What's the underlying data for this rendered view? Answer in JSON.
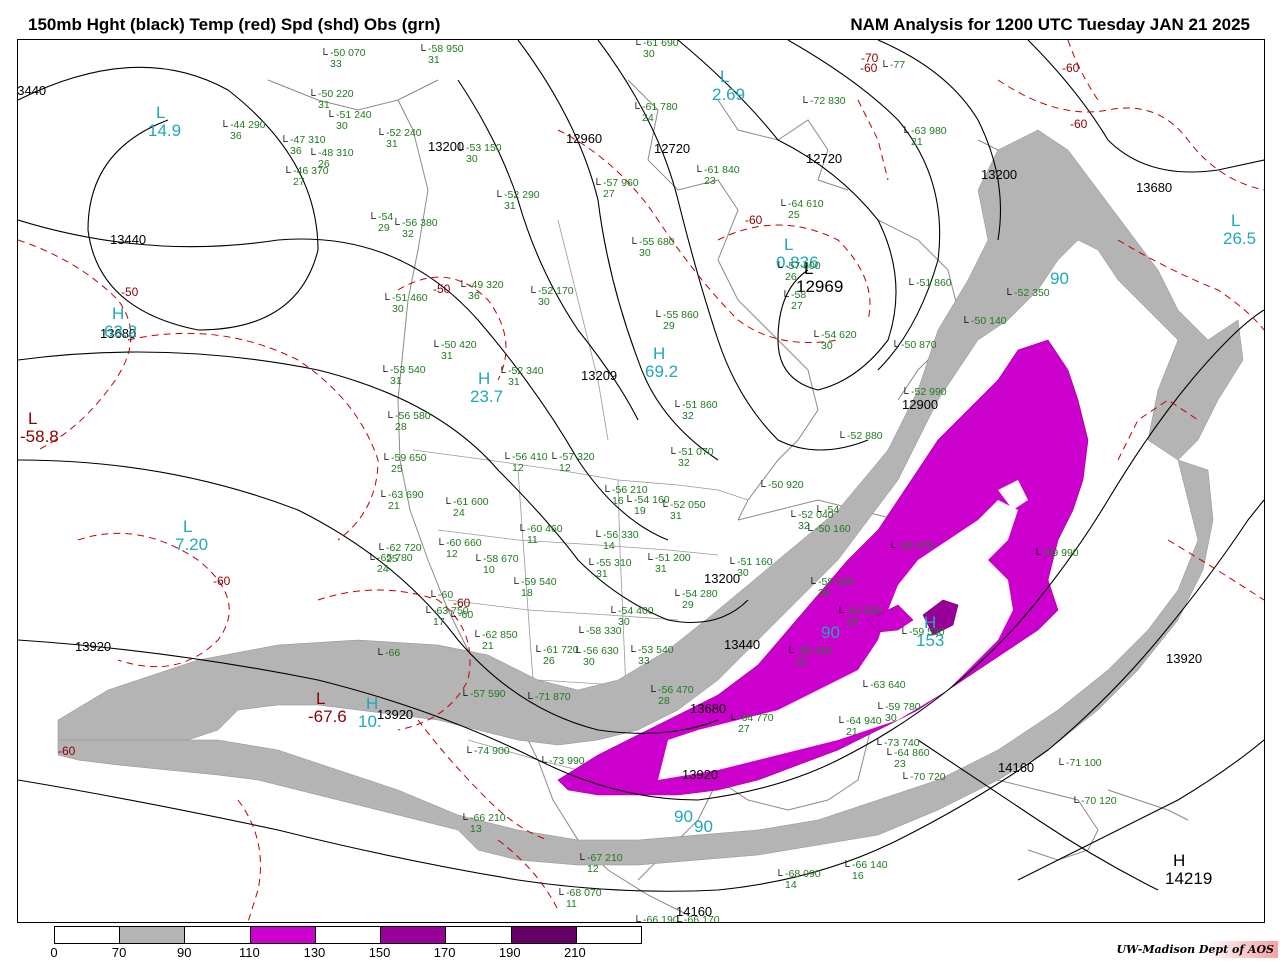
{
  "header": {
    "left_title": "150mb Hght (black) Temp (red) Spd (shd) Obs (grn)",
    "right_title": "NAM Analysis for 1200 UTC Tuesday  JAN 21 2025"
  },
  "colors": {
    "height_contour": "#000000",
    "temperature_contour": "#c00000",
    "speed_label": "#1fa9b7",
    "observation": "#1f7a1f",
    "speed_70_90": "#b4b4b4",
    "speed_110_130": "#cc00cc",
    "speed_150_170": "#990099",
    "speed_190_210": "#660066"
  },
  "legend": {
    "ticks": [
      "0",
      "70",
      "90",
      "110",
      "130",
      "150",
      "170",
      "190",
      "210"
    ],
    "fills": [
      "#ffffff",
      "#b4b4b4",
      "#ffffff",
      "#cc00cc",
      "#ffffff",
      "#990099",
      "#ffffff",
      "#660066",
      "#ffffff"
    ]
  },
  "credit": "UW-Madison  Dept of AOS",
  "height_labels": [
    "13440",
    "13440",
    "13200",
    "12960",
    "12720",
    "12720",
    "13200",
    "13680",
    "13680",
    "13209",
    "12900",
    "13200",
    "13440",
    "13680",
    "13920",
    "13920",
    "13920",
    "14160",
    "14160",
    "13920"
  ],
  "temp_labels": [
    "-50",
    "-60",
    "-60",
    "-60",
    "-70",
    "-60",
    "-60",
    "-50",
    "-60",
    "-60"
  ],
  "speed_labels": [
    "90",
    "90",
    "90",
    "90"
  ],
  "centers": [
    {
      "letter": "L",
      "value": "14.9",
      "kind": "spd"
    },
    {
      "letter": "L",
      "value": "2.69",
      "kind": "spd"
    },
    {
      "letter": "L",
      "value": "0.836",
      "kind": "spd"
    },
    {
      "letter": "L",
      "value": "12969",
      "kind": "hgt"
    },
    {
      "letter": "L",
      "value": "26.5",
      "kind": "spd"
    },
    {
      "letter": "H",
      "value": "69.2",
      "kind": "spd"
    },
    {
      "letter": "H",
      "value": "63.2",
      "kind": "spd"
    },
    {
      "letter": "L",
      "value": "7.20",
      "kind": "spd"
    },
    {
      "letter": "L",
      "value": "-58.8",
      "kind": "tmp"
    },
    {
      "letter": "L",
      "value": "-67.6",
      "kind": "tmp"
    },
    {
      "letter": "H",
      "value": "10.",
      "kind": "spd"
    },
    {
      "letter": "H",
      "value": "23.7",
      "kind": "spd"
    },
    {
      "letter": "H",
      "value": "153",
      "kind": "spd"
    },
    {
      "letter": "H",
      "value": "14219",
      "kind": "hgt"
    }
  ],
  "observations": [
    {
      "t": "-50",
      "h": "070",
      "d": "33"
    },
    {
      "t": "-58",
      "h": "950",
      "d": "31"
    },
    {
      "t": "-61",
      "h": "690",
      "d": "30"
    },
    {
      "t": "-61",
      "h": "780",
      "d": "24"
    },
    {
      "t": "-72",
      "h": "830",
      "d": ""
    },
    {
      "t": "-77",
      "h": "",
      "d": ""
    },
    {
      "t": "-63",
      "h": "980",
      "d": "21"
    },
    {
      "t": "-61",
      "h": "840",
      "d": "23"
    },
    {
      "t": "-50",
      "h": "220",
      "d": "31"
    },
    {
      "t": "-44",
      "h": "290",
      "d": "36"
    },
    {
      "t": "-51",
      "h": "240",
      "d": "30"
    },
    {
      "t": "-52",
      "h": "240",
      "d": "31"
    },
    {
      "t": "-47",
      "h": "310",
      "d": "36"
    },
    {
      "t": "-48",
      "h": "310",
      "d": "26"
    },
    {
      "t": "-46",
      "h": "370",
      "d": "27"
    },
    {
      "t": "-53",
      "h": "150",
      "d": "30"
    },
    {
      "t": "-57",
      "h": "960",
      "d": "27"
    },
    {
      "t": "-64",
      "h": "610",
      "d": "25"
    },
    {
      "t": "-57",
      "h": "600",
      "d": "26"
    },
    {
      "t": "-58",
      "h": "",
      "d": "27"
    },
    {
      "t": "-52",
      "h": "290",
      "d": "31"
    },
    {
      "t": "-54",
      "h": "",
      "d": "29"
    },
    {
      "t": "-56",
      "h": "380",
      "d": "32"
    },
    {
      "t": "-55",
      "h": "680",
      "d": "30"
    },
    {
      "t": "-51",
      "h": "860",
      "d": ""
    },
    {
      "t": "-52",
      "h": "350",
      "d": ""
    },
    {
      "t": "-49",
      "h": "320",
      "d": "36"
    },
    {
      "t": "-52",
      "h": "170",
      "d": "30"
    },
    {
      "t": "-54",
      "h": "620",
      "d": "30"
    },
    {
      "t": "-50",
      "h": "140",
      "d": ""
    },
    {
      "t": "-51",
      "h": "460",
      "d": "30"
    },
    {
      "t": "-55",
      "h": "860",
      "d": "29"
    },
    {
      "t": "-50",
      "h": "420",
      "d": "31"
    },
    {
      "t": "-52",
      "h": "340",
      "d": "31"
    },
    {
      "t": "-50",
      "h": "870",
      "d": ""
    },
    {
      "t": "-53",
      "h": "540",
      "d": "31"
    },
    {
      "t": "-56",
      "h": "580",
      "d": "28"
    },
    {
      "t": "-52",
      "h": "990",
      "d": ""
    },
    {
      "t": "-51",
      "h": "860",
      "d": "32"
    },
    {
      "t": "-52",
      "h": "880",
      "d": ""
    },
    {
      "t": "-59",
      "h": "650",
      "d": "25"
    },
    {
      "t": "-56",
      "h": "410",
      "d": "12"
    },
    {
      "t": "-57",
      "h": "320",
      "d": "12"
    },
    {
      "t": "-51",
      "h": "070",
      "d": "32"
    },
    {
      "t": "-50",
      "h": "920",
      "d": ""
    },
    {
      "t": "-63",
      "h": "690",
      "d": "21"
    },
    {
      "t": "-61",
      "h": "600",
      "d": "24"
    },
    {
      "t": "-56",
      "h": "210",
      "d": "16"
    },
    {
      "t": "-54",
      "h": "160",
      "d": "19"
    },
    {
      "t": "-52",
      "h": "050",
      "d": "31"
    },
    {
      "t": "-52",
      "h": "040",
      "d": "32"
    },
    {
      "t": "-54",
      "h": "",
      "d": ""
    },
    {
      "t": "-62",
      "h": "720",
      "d": "25"
    },
    {
      "t": "-60",
      "h": "660",
      "d": "12"
    },
    {
      "t": "-60",
      "h": "460",
      "d": "11"
    },
    {
      "t": "-56",
      "h": "330",
      "d": "14"
    },
    {
      "t": "-58",
      "h": "670",
      "d": "10"
    },
    {
      "t": "-60",
      "h": "",
      "d": ""
    },
    {
      "t": "-51",
      "h": "200",
      "d": "31"
    },
    {
      "t": "-51",
      "h": "160",
      "d": "30"
    },
    {
      "t": "-50",
      "h": "160",
      "d": ""
    },
    {
      "t": "-53",
      "h": "470",
      "d": ""
    },
    {
      "t": "-69",
      "h": "990",
      "d": ""
    },
    {
      "t": "-65",
      "h": "780",
      "d": "24"
    },
    {
      "t": "-59",
      "h": "540",
      "d": "18"
    },
    {
      "t": "-55",
      "h": "310",
      "d": "31"
    },
    {
      "t": "-54",
      "h": "280",
      "d": "29"
    },
    {
      "t": "-58",
      "h": "450",
      "d": "29"
    },
    {
      "t": "-61",
      "h": "530",
      "d": "23"
    },
    {
      "t": "-63",
      "h": "750",
      "d": "17"
    },
    {
      "t": "-60",
      "h": "",
      "d": ""
    },
    {
      "t": "-54",
      "h": "400",
      "d": "30"
    },
    {
      "t": "-58",
      "h": "330",
      "d": ""
    },
    {
      "t": "-59",
      "h": "530",
      "d": ""
    },
    {
      "t": "-66",
      "h": "",
      "d": ""
    },
    {
      "t": "-62",
      "h": "850",
      "d": "21"
    },
    {
      "t": "-61",
      "h": "720",
      "d": "26"
    },
    {
      "t": "-56",
      "h": "630",
      "d": "30"
    },
    {
      "t": "-53",
      "h": "540",
      "d": "33"
    },
    {
      "t": "-56",
      "h": "410",
      "d": "31"
    },
    {
      "t": "-56",
      "h": "470",
      "d": "28"
    },
    {
      "t": "-63",
      "h": "640",
      "d": ""
    },
    {
      "t": "-57",
      "h": "590",
      "d": ""
    },
    {
      "t": "-71",
      "h": "870",
      "d": ""
    },
    {
      "t": "-64",
      "h": "770",
      "d": "27"
    },
    {
      "t": "-59",
      "h": "780",
      "d": "30"
    },
    {
      "t": "-73",
      "h": "740",
      "d": ""
    },
    {
      "t": "-74",
      "h": "900",
      "d": ""
    },
    {
      "t": "-73",
      "h": "990",
      "d": ""
    },
    {
      "t": "-64",
      "h": "940",
      "d": "21"
    },
    {
      "t": "-64",
      "h": "860",
      "d": "23"
    },
    {
      "t": "-70",
      "h": "720",
      "d": ""
    },
    {
      "t": "-71",
      "h": "100",
      "d": ""
    },
    {
      "t": "-70",
      "h": "120",
      "d": ""
    },
    {
      "t": "-66",
      "h": "210",
      "d": "13"
    },
    {
      "t": "-67",
      "h": "210",
      "d": "12"
    },
    {
      "t": "-68",
      "h": "070",
      "d": "11"
    },
    {
      "t": "-68",
      "h": "090",
      "d": "14"
    },
    {
      "t": "-66",
      "h": "140",
      "d": "16"
    },
    {
      "t": "-66",
      "h": "190",
      "d": "14"
    },
    {
      "t": "-66",
      "h": "170",
      "d": "12"
    },
    {
      "t": "-65",
      "h": "180",
      "d": ""
    },
    {
      "t": "-63",
      "h": "190",
      "d": ""
    }
  ]
}
